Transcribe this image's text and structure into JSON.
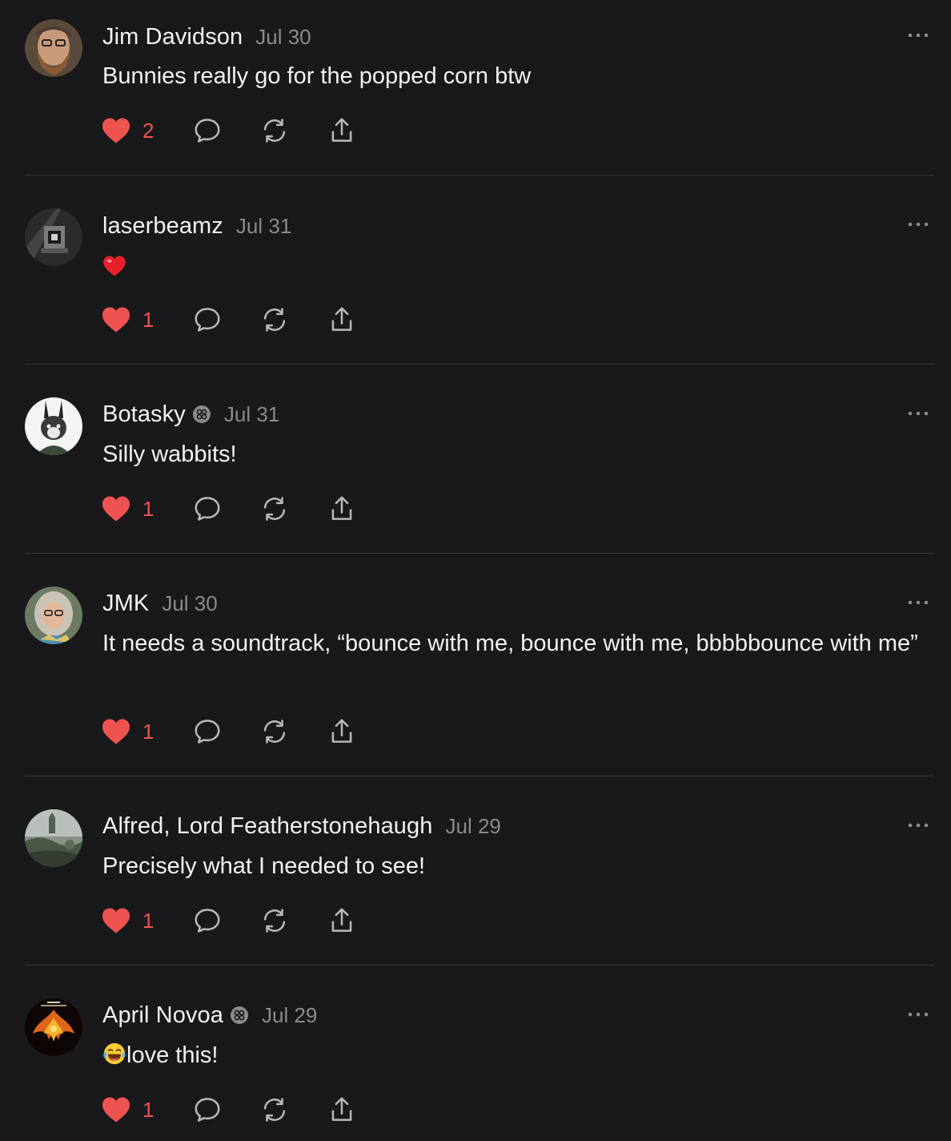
{
  "comments": [
    {
      "name": "Jim Davidson",
      "date": "Jul 30",
      "text": "Bunnies really go for the popped corn btw",
      "likes": "2",
      "verified": false
    },
    {
      "name": "laserbeamz",
      "date": "Jul 31",
      "text": "",
      "emoji": "heart",
      "likes": "1",
      "verified": false
    },
    {
      "name": "Botasky",
      "date": "Jul 31",
      "text": "Silly wabbits!",
      "likes": "1",
      "verified": true
    },
    {
      "name": "JMK",
      "date": "Jul 30",
      "text": "It needs a soundtrack, “bounce with me, bounce with me, bbbbbounce with me”",
      "likes": "1",
      "verified": false
    },
    {
      "name": "Alfred, Lord Featherstonehaugh",
      "date": "Jul 29",
      "text": "Precisely what I needed to see!",
      "likes": "1",
      "verified": false
    },
    {
      "name": "April Novoa",
      "date": "Jul 29",
      "text": "love this!",
      "emoji": "laughing-tears",
      "likes": "1",
      "verified": true
    }
  ],
  "icons": {
    "like": "heart-icon",
    "reply": "speech-bubble-icon",
    "restack": "restack-icon",
    "share": "share-icon",
    "more": "more-dots-icon",
    "badge": "verified-badge-icon"
  },
  "colors": {
    "background": "#19191b",
    "accent_like": "#ef5350",
    "muted": "#8a8a8e",
    "divider": "#38383c"
  }
}
